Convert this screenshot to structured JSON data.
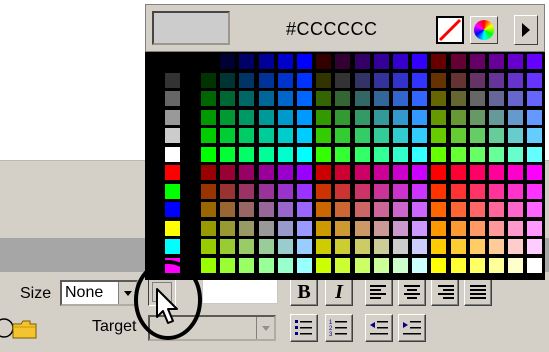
{
  "picker": {
    "hex_value": "#CCCCCC",
    "preview_color": "#cccccc",
    "gray_ramp": [
      "#000000",
      "#333333",
      "#666666",
      "#999999",
      "#cccccc",
      "#ffffff"
    ],
    "basic_colors": [
      "#ff0000",
      "#00ff00",
      "#0000ff",
      "#ffff00",
      "#00ffff",
      "#ff00ff"
    ],
    "cube_levels": [
      0,
      51,
      102,
      153,
      204,
      255
    ]
  },
  "properties": {
    "size_label": "Size",
    "size_value": "None",
    "target_label": "Target",
    "bold_label": "B",
    "italic_label": "I"
  }
}
